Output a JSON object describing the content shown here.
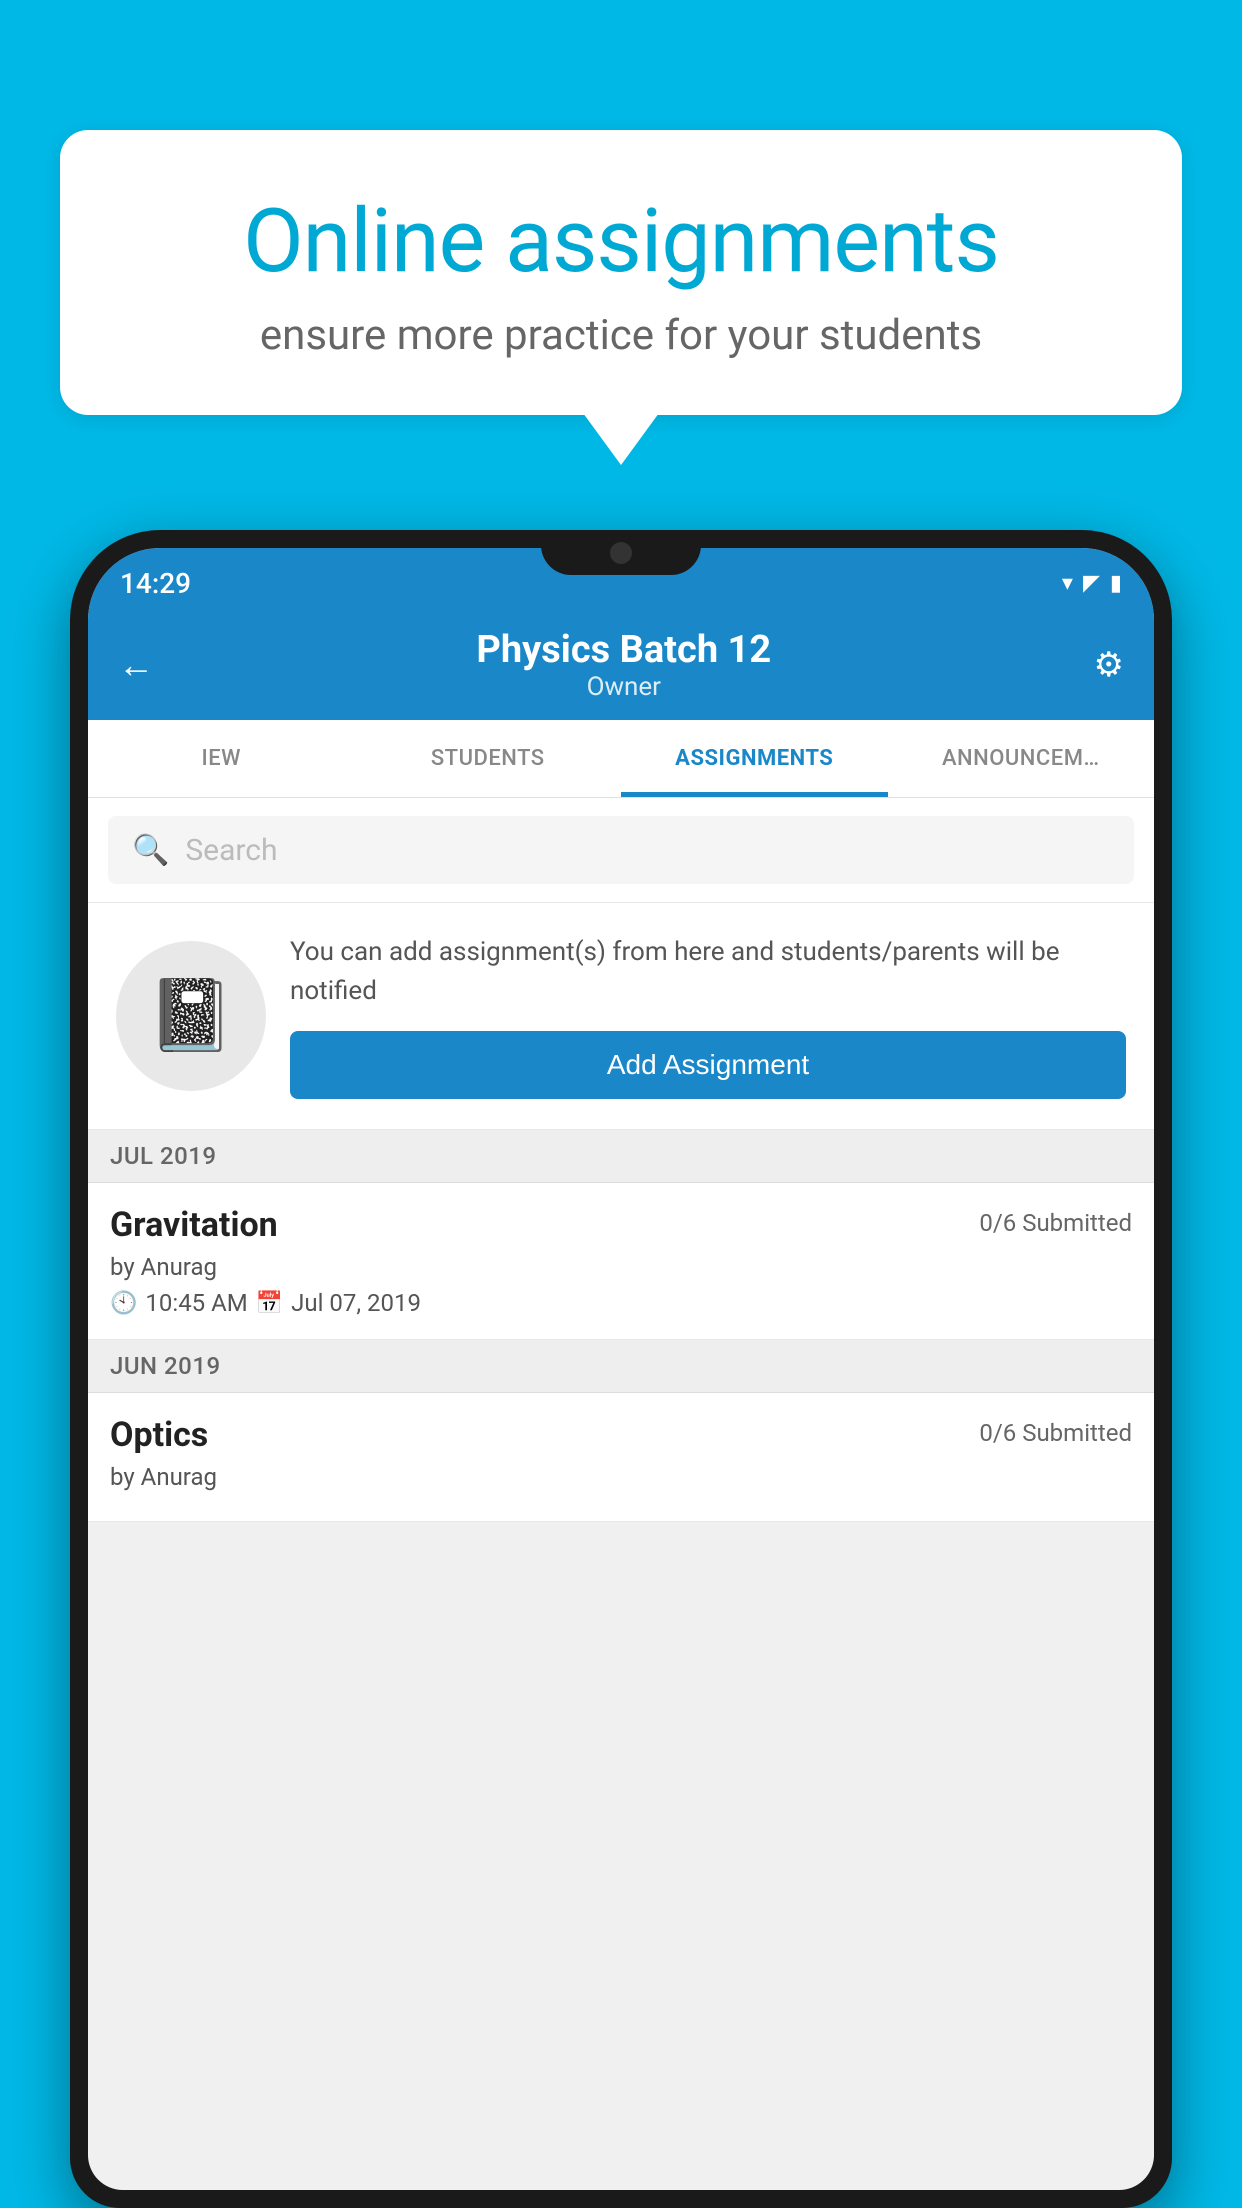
{
  "background": {
    "color": "#00b8e6"
  },
  "speech_bubble": {
    "title": "Online assignments",
    "subtitle": "ensure more practice for your students"
  },
  "status_bar": {
    "time": "14:29",
    "wifi_icon": "▾",
    "signal_icon": "▲",
    "battery_icon": "▮"
  },
  "header": {
    "back_icon": "←",
    "title": "Physics Batch 12",
    "subtitle": "Owner",
    "settings_icon": "⚙"
  },
  "tabs": [
    {
      "label": "IEW",
      "active": false
    },
    {
      "label": "STUDENTS",
      "active": false
    },
    {
      "label": "ASSIGNMENTS",
      "active": true
    },
    {
      "label": "ANNOUNCEM…",
      "active": false
    }
  ],
  "search": {
    "placeholder": "Search"
  },
  "promo": {
    "description": "You can add assignment(s) from here and students/parents will be notified",
    "button_label": "Add Assignment"
  },
  "assignment_sections": [
    {
      "month": "JUL 2019",
      "assignments": [
        {
          "name": "Gravitation",
          "submitted": "0/6 Submitted",
          "by": "by Anurag",
          "time": "10:45 AM",
          "date": "Jul 07, 2019"
        }
      ]
    },
    {
      "month": "JUN 2019",
      "assignments": [
        {
          "name": "Optics",
          "submitted": "0/6 Submitted",
          "by": "by Anurag",
          "time": "",
          "date": ""
        }
      ]
    }
  ]
}
